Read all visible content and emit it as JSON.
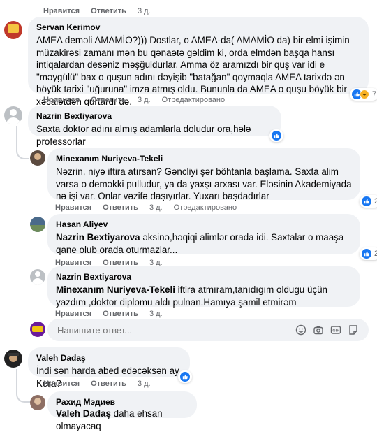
{
  "top_actions": {
    "like": "Нравится",
    "reply": "Ответить",
    "time": "3 д."
  },
  "comments": [
    {
      "author": "Servan Kerimov",
      "text": "AMEA deməli AMAMİO?))) Dostlar, o AMEA-da( AMAMİO da) bir elmi işimin müzakirəsi zamanı mən bu qənaətə gəldim ki, orda elmdən başqa hansı intiqalardan desəniz məşğuldurlar. Amma öz aramızdı bir quş var idi e \"məygülü\" bax o quşun adını dəyişib \"batağan\" qoymaqla AMEA tarixdə ən böyük tarixi \"uğuruna\" imza atmış oldu. Bununla da AMEA o quşu böyük bir xəcalətdən qurtardı də.",
      "like": "Нравится",
      "reply": "Ответить",
      "time": "3 д.",
      "edited": "Отредактировано",
      "reaction_count": "7"
    },
    {
      "author": "Nazrin Bextiyarova",
      "text": "Saxta doktor adını almış adamlarla doludur ora,hələ professorlar"
    },
    {
      "author": "Minexanım Nuriyeva-Tekeli",
      "text": "Nəzrin, niyə iftira atırsan? Gəncliyi şər böhtanla başlama. Saxta alim varsa o deməkki pulludur, ya da yaxşı arxası var. Eləsinin Akademiyada nə işi var. Onlar vəzifə daşıyırlar. Yuxarı başdadırlar",
      "like": "Нравится",
      "reply": "Ответить",
      "time": "3 д.",
      "edited": "Отредактировано",
      "reaction_count": "2"
    },
    {
      "author": "Hasan Aliyev",
      "mention": "Nazrin Bextiyarova",
      "text": " əksinə,həqiqi alimlər orada idi. Saxtalar o maaşa qane olub orada oturmazlar...",
      "like": "Нравится",
      "reply": "Ответить",
      "time": "3 д.",
      "reaction_count": "2"
    },
    {
      "author": "Nazrin Bextiyarova",
      "mention": "Minexanım Nuriyeva-Tekeli",
      "text": " iftira atmıram,tanıdıgım oldugu üçün yazdım ,doktor diplomu aldı pulnan.Hamıya şamil etmirəm",
      "like": "Нравится",
      "reply": "Ответить",
      "time": "3 д."
    },
    {
      "author": "Valeh Dadaş",
      "text": "İndi sən harda abed edəcəksən ay Kera?",
      "like": "Нравится",
      "reply": "Ответить",
      "time": "3 д."
    },
    {
      "author": "Рахид Мэдиев",
      "mention": "Valeh Dadaş",
      "text": " daha ehsan olmayacaq"
    }
  ],
  "reply_box": {
    "placeholder": "Напишите ответ..."
  },
  "icons": [
    "like-icon",
    "haha-icon",
    "emoji-icon",
    "camera-icon",
    "gif-icon",
    "sticker-icon"
  ],
  "colors": {
    "bubble": "#f0f2f5",
    "meta": "#65676b",
    "like": "#1877f2",
    "haha": "#f7b125"
  }
}
